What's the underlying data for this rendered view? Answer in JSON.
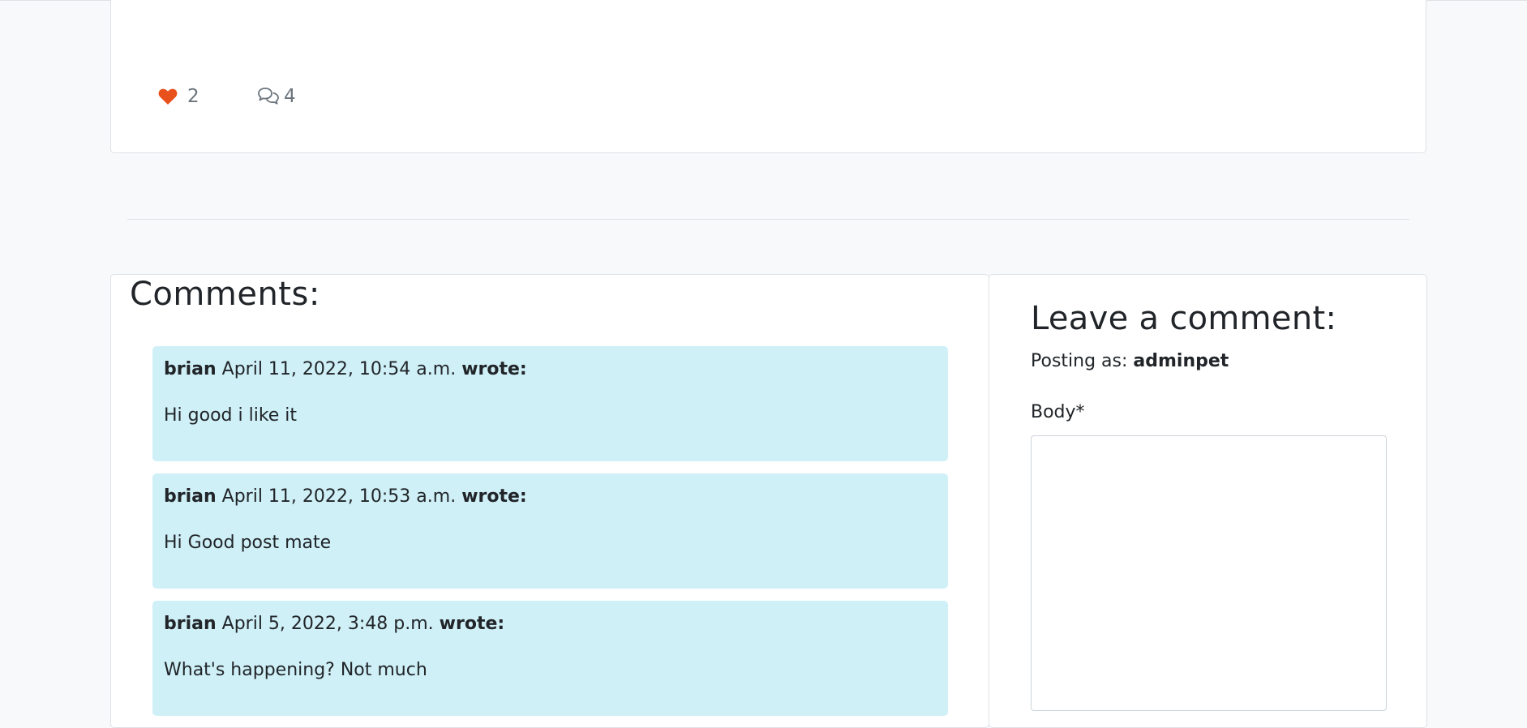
{
  "post_card": {
    "likes_count": "2",
    "comments_count": "4",
    "like_color": "#e8501c"
  },
  "comments_section": {
    "title": "Comments:",
    "comments": [
      {
        "author": "brian",
        "date": "April 11, 2022, 10:54 a.m.",
        "wrote": "wrote:",
        "body": "Hi good i like it"
      },
      {
        "author": "brian",
        "date": "April 11, 2022, 10:53 a.m.",
        "wrote": "wrote:",
        "body": "Hi Good post mate"
      },
      {
        "author": "brian",
        "date": "April 5, 2022, 3:48 p.m.",
        "wrote": "wrote:",
        "body": "What's happening? Not much"
      }
    ],
    "comment_bg_color": "#cff0f7"
  },
  "comment_form": {
    "title": "Leave a comment:",
    "posting_as_label": "Posting as:",
    "username": "adminpet",
    "body_label": "Body*",
    "body_value": ""
  }
}
